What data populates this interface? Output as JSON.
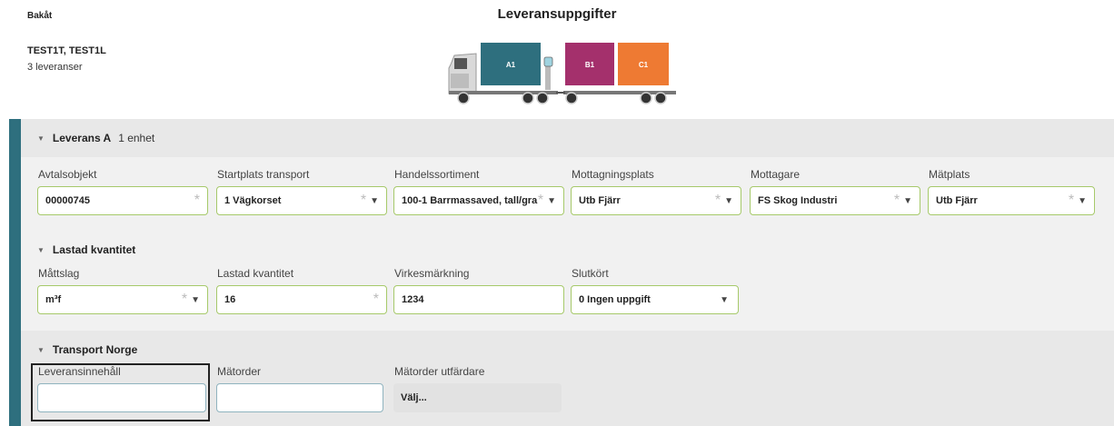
{
  "header": {
    "back_label": "Bakåt",
    "title": "Leveransuppgifter",
    "vehicle": "TEST1T, TEST1L",
    "delivery_count": "3 leveranser"
  },
  "truck": {
    "units": [
      {
        "label": "A1",
        "color": "#2e6f7e"
      },
      {
        "label": "B1",
        "color": "#a4306c"
      },
      {
        "label": "C1",
        "color": "#ee7a33"
      }
    ]
  },
  "delivery": {
    "title": "Leverans A",
    "count": "1 enhet",
    "fields": [
      {
        "label": "Avtalsobjekt",
        "value": "00000745"
      },
      {
        "label": "Startplats transport",
        "value": "1 Vägkorset"
      },
      {
        "label": "Handelssortiment",
        "value": "100-1 Barrmassaved, tall/gra"
      },
      {
        "label": "Mottagningsplats",
        "value": "Utb Fjärr"
      },
      {
        "label": "Mottagare",
        "value": "FS Skog Industri"
      },
      {
        "label": "Mätplats",
        "value": "Utb Fjärr"
      }
    ]
  },
  "loaded": {
    "title": "Lastad kvantitet",
    "fields": [
      {
        "label": "Måttslag",
        "value": "m³f"
      },
      {
        "label": "Lastad kvantitet",
        "value": "16"
      },
      {
        "label": "Virkesmärkning",
        "value": "1234"
      },
      {
        "label": "Slutkört",
        "value": "0 Ingen uppgift"
      }
    ]
  },
  "norway": {
    "title": "Transport Norge",
    "fields": [
      {
        "label": "Leveransinnehåll",
        "value": ""
      },
      {
        "label": "Mätorder",
        "value": ""
      },
      {
        "label": "Mätorder utfärdare",
        "value": "Välj..."
      }
    ]
  },
  "icons": {
    "collapse": "triangle-down-icon",
    "required": "asterisk-icon",
    "dropdown": "chevron-down-icon"
  }
}
